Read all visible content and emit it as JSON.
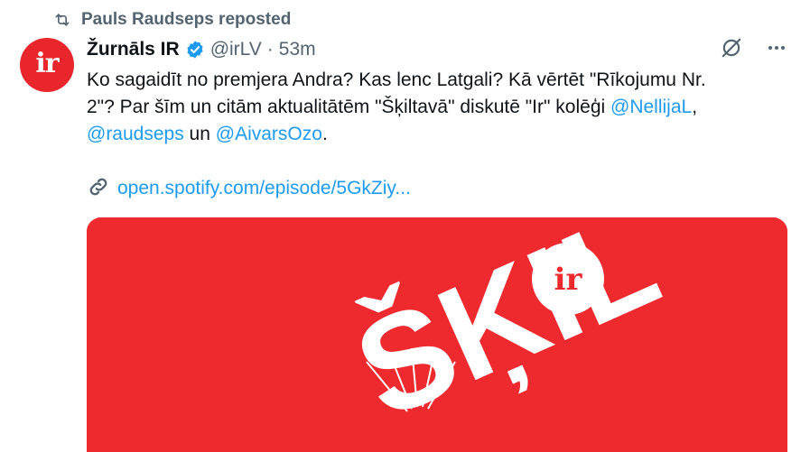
{
  "repost": {
    "icon": "repost-icon",
    "text": "Pauls Raudseps reposted"
  },
  "author": {
    "avatar_text": "ir",
    "name": "Žurnāls IR",
    "handle": "@irLV",
    "separator": "·",
    "time": "53m",
    "verified": true
  },
  "tweet": {
    "line1": "Ko sagaidīt no premjera Andra? Kas lenc Latgali? Kā vērtēt \"Rīkojumu Nr.",
    "line2_text": "2\"? Par šīm un citām aktualitātēm \"Šķiltavā\" diskutē \"Ir\" kolēģi ",
    "mention1": "@NellijaL",
    "comma": ",",
    "mention2": "@raudseps",
    "and": " un ",
    "mention3": "@AivarsOzo",
    "period": "."
  },
  "link": {
    "icon": "link-icon",
    "text": "open.spotify.com/episode/5GkZiy..."
  },
  "card": {
    "title": "ŠĶIL",
    "logo_text": "ir"
  },
  "actions": {
    "grok_icon": "grok-icon",
    "more_icon": "more-icon"
  },
  "colors": {
    "brand_red": "#ee2a2e",
    "link_blue": "#1d9bf0",
    "muted": "#536471",
    "verified_blue": "#1d9bf0"
  }
}
